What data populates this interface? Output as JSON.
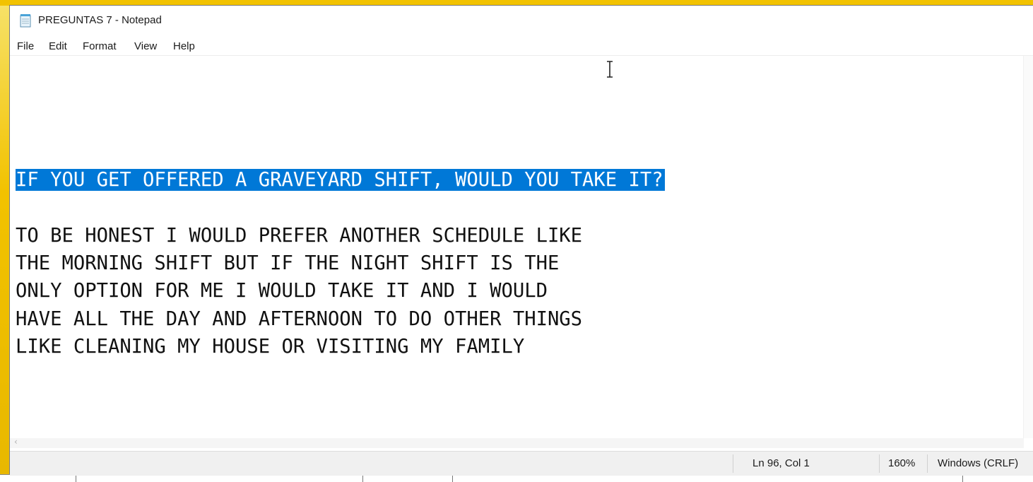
{
  "window": {
    "title": "PREGUNTAS 7 - Notepad",
    "app_icon": "notepad-icon"
  },
  "menu": {
    "file": "File",
    "edit": "Edit",
    "format": "Format",
    "view": "View",
    "help": "Help"
  },
  "editor": {
    "selected_line": "IF YOU GET OFFERED A GRAVEYARD SHIFT, WOULD YOU TAKE IT?",
    "lines": [
      "TO BE HONEST I WOULD PREFER ANOTHER SCHEDULE LIKE",
      "THE MORNING SHIFT BUT IF THE NIGHT SHIFT IS THE",
      "ONLY OPTION FOR ME I WOULD TAKE IT AND I WOULD",
      "HAVE ALL THE DAY AND AFTERNOON TO DO OTHER THINGS",
      "LIKE CLEANING MY HOUSE OR VISITING MY FAMILY"
    ],
    "selection_color": "#0078d7"
  },
  "status": {
    "position": "Ln 96, Col 1",
    "zoom": "160%",
    "line_endings": "Windows (CRLF)"
  }
}
